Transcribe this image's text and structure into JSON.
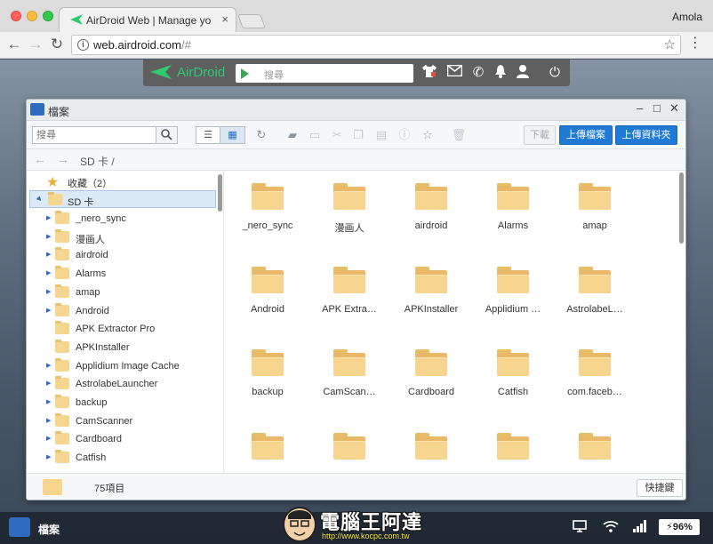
{
  "browser": {
    "tab_title": "AirDroid Web | Manage your p",
    "tab_close": "×",
    "profile_name": "Amola",
    "url_main": "web.airdroid.com",
    "url_rest": "/#"
  },
  "airdroid_bar": {
    "brand": "AirDroid",
    "search_placeholder": "搜尋",
    "icons": [
      "tshirt-icon",
      "mail-icon",
      "phone-icon",
      "bell-icon",
      "user-icon",
      "power-icon"
    ]
  },
  "file_manager": {
    "title": "檔案",
    "search_placeholder": "搜尋",
    "download_label": "下載",
    "upload_file_label": "上傳檔案",
    "upload_folder_label": "上傳資料夾",
    "path": "SD 卡 /",
    "sidebar": {
      "favorites_label": "收藏（2）",
      "sd_label": "SD 卡",
      "items": [
        {
          "label": "_nero_sync",
          "expandable": true
        },
        {
          "label": "漫画人",
          "expandable": true
        },
        {
          "label": "airdroid",
          "expandable": true
        },
        {
          "label": "Alarms",
          "expandable": true
        },
        {
          "label": "amap",
          "expandable": true
        },
        {
          "label": "Android",
          "expandable": true
        },
        {
          "label": "APK Extractor Pro",
          "expandable": false
        },
        {
          "label": "APKInstaller",
          "expandable": false
        },
        {
          "label": "Applidium Image Cache",
          "expandable": true
        },
        {
          "label": "AstrolabeLauncher",
          "expandable": true
        },
        {
          "label": "backup",
          "expandable": true
        },
        {
          "label": "CamScanner",
          "expandable": true
        },
        {
          "label": "Cardboard",
          "expandable": true
        },
        {
          "label": "Catfish",
          "expandable": true
        }
      ]
    },
    "grid_items": [
      "_nero_sync",
      "漫画人",
      "airdroid",
      "Alarms",
      "amap",
      "Android",
      "APK Extra…",
      "APKInstaller",
      "Applidium …",
      "AstrolabeL…",
      "backup",
      "CamScan…",
      "Cardboard",
      "Catfish",
      "com.faceb…",
      "",
      "",
      "",
      "",
      ""
    ],
    "status_count": "75項目",
    "shortcut_label": "快捷鍵"
  },
  "taskbar": {
    "app_label": "檔案",
    "watermark_title": "電腦王阿達",
    "watermark_url": "http://www.kocpc.com.tw",
    "battery": "96%"
  }
}
